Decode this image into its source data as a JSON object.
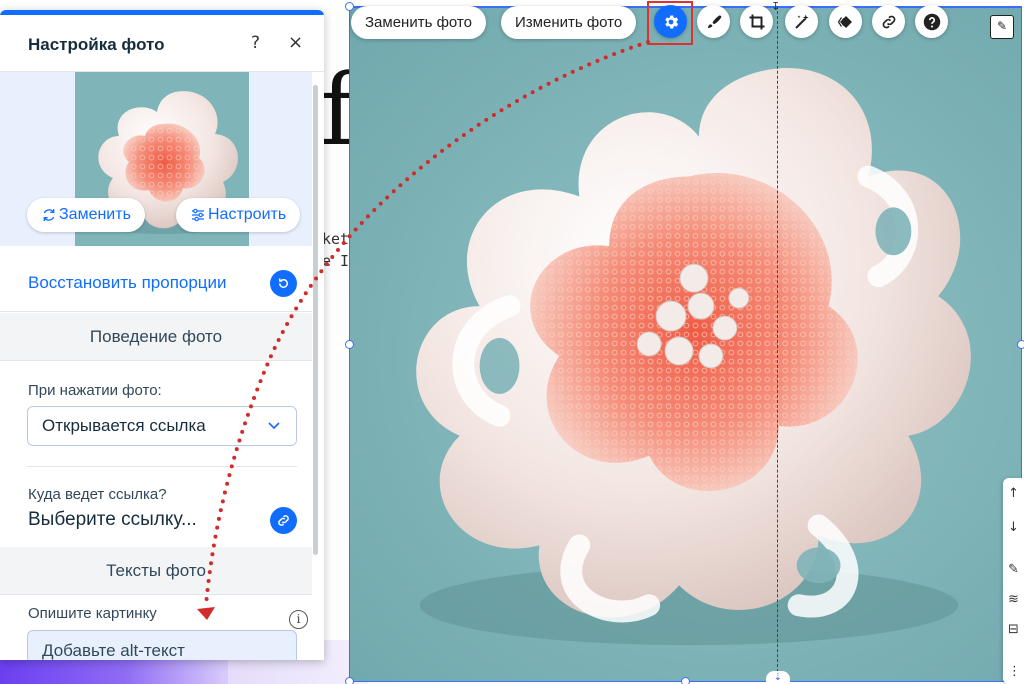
{
  "canvas": {
    "big_glyph": "f",
    "code_line_1": "ket",
    "code_line_2": "e I"
  },
  "toolbar": {
    "replace_photo_label": "Заменить фото",
    "edit_photo_label": "Изменить фото",
    "icons": [
      "gear-icon",
      "brush-icon",
      "crop-icon",
      "magic-wand-icon",
      "animation-icon",
      "link-icon",
      "help-icon"
    ],
    "highlight_color": "#e03131",
    "accent_color": "#116dff"
  },
  "panel": {
    "title": "Настройка фото",
    "help_glyph": "?",
    "close_glyph": "×",
    "replace_label": "Заменить",
    "adjust_label": "Настроить",
    "restore_label": "Восстановить пропорции",
    "behavior_section": "Поведение фото",
    "on_click_label": "При нажатии фото:",
    "on_click_value": "Открывается ссылка",
    "link_target_label": "Куда ведет ссылка?",
    "link_target_value": "Выберите ссылку...",
    "texts_section": "Тексты фото",
    "describe_label": "Опишите картинку",
    "info_glyph": "i",
    "alt_placeholder": "Добавьте alt-текст"
  }
}
